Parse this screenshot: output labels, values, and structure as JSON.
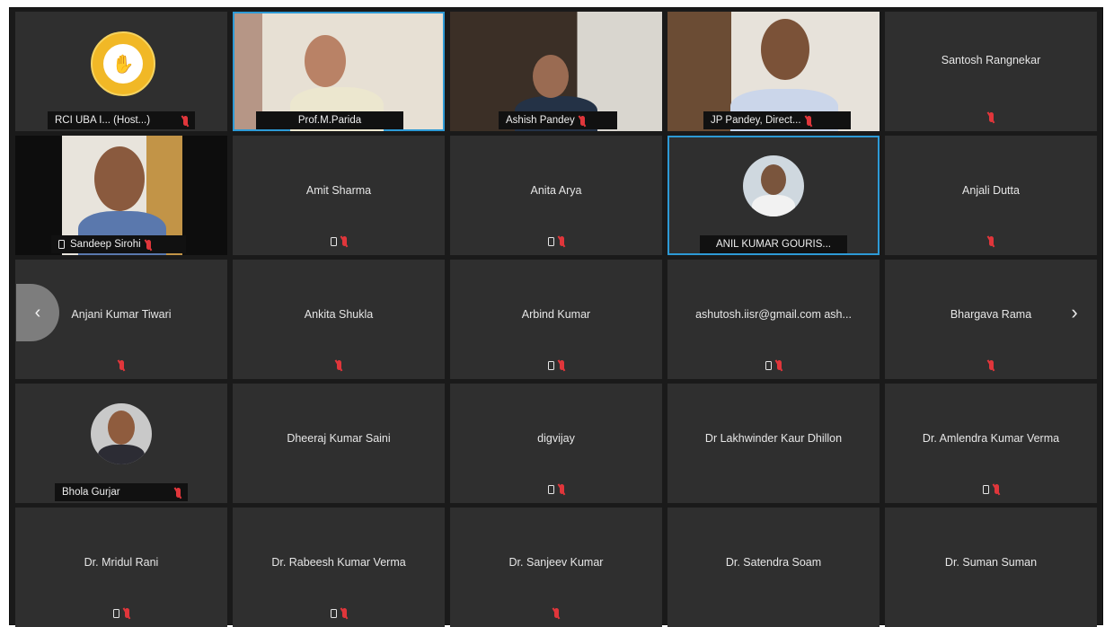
{
  "meeting": {
    "tiles": [
      {
        "id": "t1",
        "name": "RCI UBA I... (Host...)",
        "type": "logo"
      },
      {
        "id": "t2",
        "name": "Prof.M.Parida",
        "type": "video"
      },
      {
        "id": "t3",
        "name": "Ashish Pandey",
        "type": "video"
      },
      {
        "id": "t4",
        "name": "JP Pandey, Direct...",
        "type": "video"
      },
      {
        "id": "t5",
        "name": "Santosh Rangnekar",
        "type": "name"
      },
      {
        "id": "t6",
        "name": "Sandeep Sirohi",
        "type": "video"
      },
      {
        "id": "t7",
        "name": "Amit Sharma",
        "type": "name"
      },
      {
        "id": "t8",
        "name": "Anita Arya",
        "type": "name"
      },
      {
        "id": "t9",
        "name": "ANIL KUMAR GOURIS...",
        "type": "avatar"
      },
      {
        "id": "t10",
        "name": "Anjali Dutta",
        "type": "name"
      },
      {
        "id": "t11",
        "name": "Anjani Kumar Tiwari",
        "type": "name"
      },
      {
        "id": "t12",
        "name": "Ankita Shukla",
        "type": "name"
      },
      {
        "id": "t13",
        "name": "Arbind Kumar",
        "type": "name"
      },
      {
        "id": "t14",
        "name": "ashutosh.iisr@gmail.com ash...",
        "type": "name"
      },
      {
        "id": "t15",
        "name": "Bhargava Rama",
        "type": "name"
      },
      {
        "id": "t16",
        "name": "Bhola Gurjar",
        "type": "avatar"
      },
      {
        "id": "t17",
        "name": "Dheeraj Kumar Saini",
        "type": "name"
      },
      {
        "id": "t18",
        "name": "digvijay",
        "type": "name"
      },
      {
        "id": "t19",
        "name": "Dr Lakhwinder Kaur Dhillon",
        "type": "name"
      },
      {
        "id": "t20",
        "name": "Dr. Amlendra Kumar Verma",
        "type": "name"
      },
      {
        "id": "t21",
        "name": "Dr. Mridul Rani",
        "type": "name"
      },
      {
        "id": "t22",
        "name": "Dr. Rabeesh Kumar Verma",
        "type": "name"
      },
      {
        "id": "t23",
        "name": "Dr. Sanjeev Kumar",
        "type": "name"
      },
      {
        "id": "t24",
        "name": "Dr. Satendra Soam",
        "type": "name"
      },
      {
        "id": "t25",
        "name": "Dr. Suman Suman",
        "type": "name"
      }
    ],
    "nav": {
      "prev": "‹",
      "next": "›"
    }
  }
}
